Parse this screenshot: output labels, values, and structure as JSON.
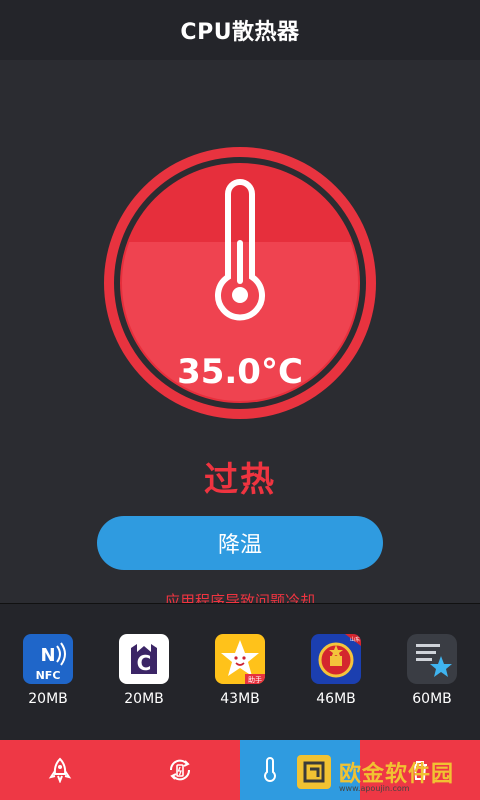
{
  "header": {
    "title": "CPU散热器"
  },
  "gauge": {
    "temperature": "35.0°C",
    "icon": "thermometer-icon",
    "outer_color": "#e8333f",
    "inner_color": "#ef3d4b"
  },
  "status": {
    "label": "过热"
  },
  "cool_button": {
    "label": "降温"
  },
  "hint": {
    "text": "应用程序导致问题冷却"
  },
  "apps": [
    {
      "name": "nfc-app",
      "size": "20MB",
      "icon_text": "NFC"
    },
    {
      "name": "c-app",
      "size": "20MB",
      "icon_text": "C"
    },
    {
      "name": "star-helper-app",
      "size": "43MB",
      "icon_text": "助手"
    },
    {
      "name": "emblem-app",
      "size": "46MB",
      "icon_text": "山东"
    },
    {
      "name": "notes-star-app",
      "size": "60MB",
      "icon_text": ""
    }
  ],
  "tabs": [
    {
      "name": "tab-rocket",
      "icon": "rocket-icon",
      "active": false
    },
    {
      "name": "tab-battery-refresh",
      "icon": "battery-refresh-icon",
      "active": false
    },
    {
      "name": "tab-cpu-cooler",
      "icon": "thermometer-icon",
      "active": true
    },
    {
      "name": "tab-trash",
      "icon": "trash-icon",
      "active": false
    }
  ],
  "watermark": {
    "text": "欧金软件园",
    "sub": "www.apoujin.com"
  },
  "colors": {
    "accent_red": "#ef3440",
    "accent_blue": "#2f9be0",
    "background": "#2b2c31"
  }
}
